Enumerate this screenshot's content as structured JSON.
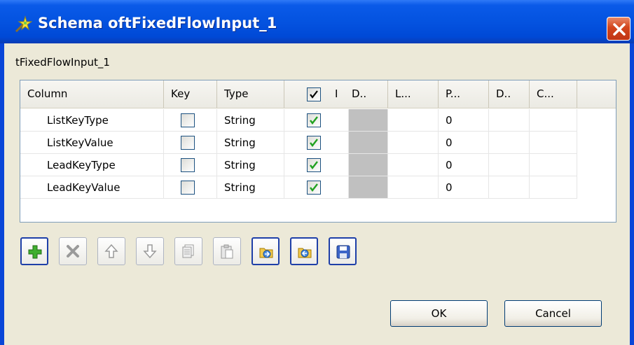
{
  "window": {
    "title": "Schema oftFixedFlowInput_1",
    "subtitle": "tFixedFlowInput_1"
  },
  "table": {
    "columns": [
      "Column",
      "Key",
      "Type",
      "",
      "I",
      "D..",
      "L...",
      "P...",
      "D..",
      "C..."
    ],
    "header_checkbox_checked": true,
    "rows": [
      {
        "column": "ListKeyType",
        "key": false,
        "type": "String",
        "nullable": true,
        "precision": "0"
      },
      {
        "column": "ListKeyValue",
        "key": false,
        "type": "String",
        "nullable": true,
        "precision": "0"
      },
      {
        "column": "LeadKeyType",
        "key": false,
        "type": "String",
        "nullable": true,
        "precision": "0"
      },
      {
        "column": "LeadKeyValue",
        "key": false,
        "type": "String",
        "nullable": true,
        "precision": "0"
      }
    ]
  },
  "toolbar": {
    "buttons": [
      {
        "icon": "add-icon",
        "enabled": true
      },
      {
        "icon": "delete-icon",
        "enabled": false
      },
      {
        "icon": "move-up-icon",
        "enabled": false
      },
      {
        "icon": "move-down-icon",
        "enabled": false
      },
      {
        "icon": "copy-icon",
        "enabled": false
      },
      {
        "icon": "paste-icon",
        "enabled": false
      },
      {
        "icon": "import-icon",
        "enabled": true
      },
      {
        "icon": "export-icon",
        "enabled": true
      },
      {
        "icon": "save-icon",
        "enabled": true
      }
    ]
  },
  "buttons": {
    "ok_label": "OK",
    "cancel_label": "Cancel"
  },
  "colors": {
    "titlebar": "#0453e0",
    "client_bg": "#ece9d8",
    "check_green": "#21a121",
    "close_red": "#d2451c"
  }
}
